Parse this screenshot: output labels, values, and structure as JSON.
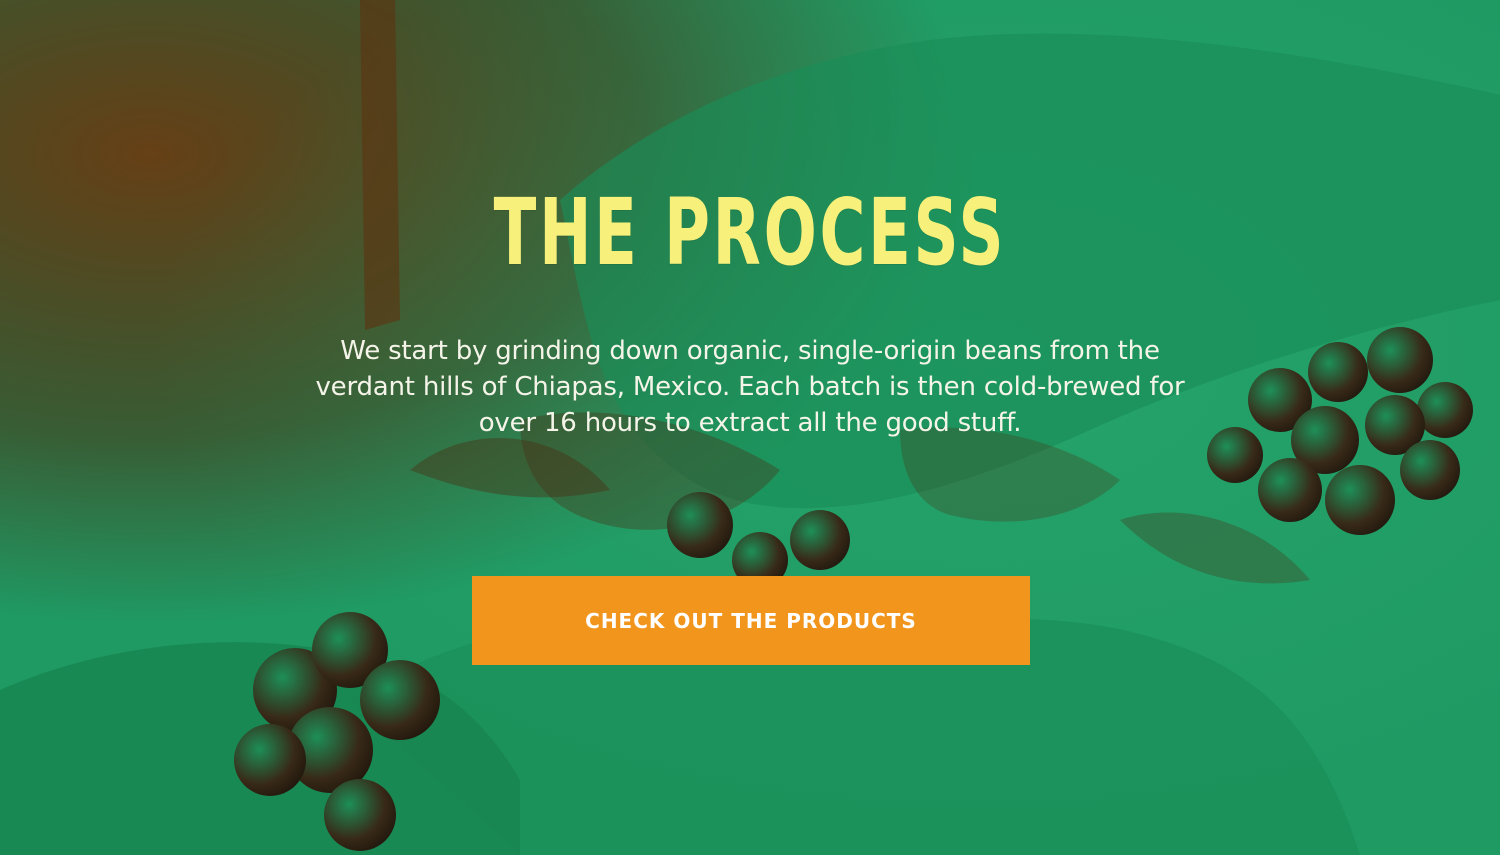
{
  "hero": {
    "title": "THE PROCESS",
    "description": "We start by grinding down organic, single-origin beans from the verdant hills of Chiapas, Mexico. Each batch is then cold-brewed for over 16 hours to extract all the good stuff.",
    "cta_label": "CHECK OUT THE PRODUCTS",
    "background_image": "hands-picking-coffee-cherries-duotone"
  },
  "colors": {
    "overlay_green": "#1f9a63",
    "shadow_brown": "#5a3412",
    "title_yellow": "#f7f07a",
    "text_light": "#f4f4e8",
    "cta_orange": "#f2951c"
  }
}
